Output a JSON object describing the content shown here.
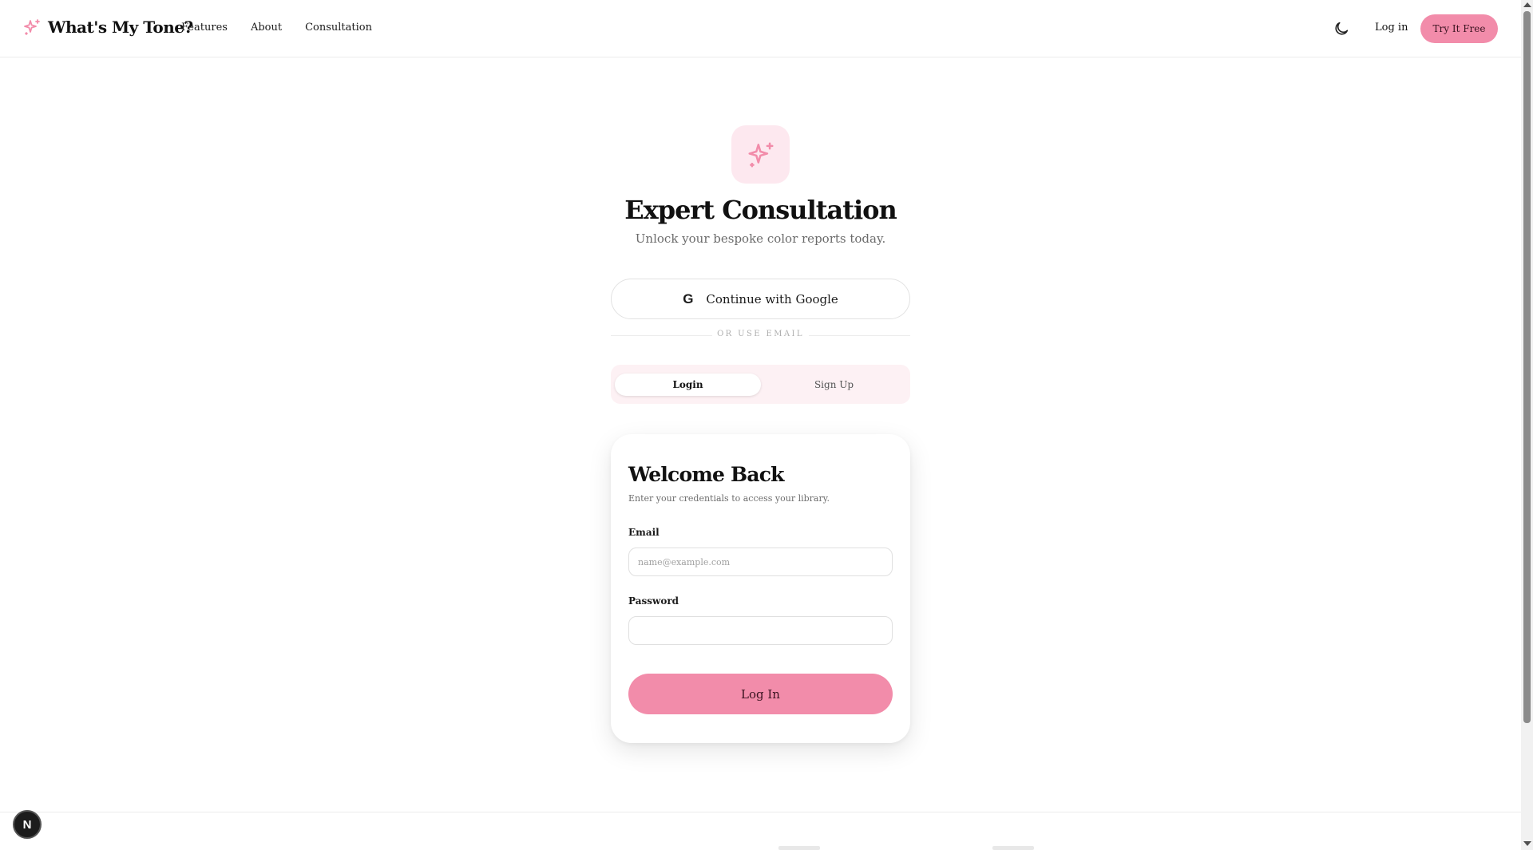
{
  "header": {
    "brand_name": "What's My Tone?",
    "brand_icon": "sparkle-icon",
    "nav": [
      {
        "label": "Features"
      },
      {
        "label": "About"
      },
      {
        "label": "Consultation"
      }
    ],
    "theme_icon": "moon-icon",
    "login_label": "Log in",
    "cta_label": "Try It Free"
  },
  "hero": {
    "icon": "sparkle-icon",
    "title": "Expert Consultation",
    "subtitle": "Unlock your bespoke color reports today."
  },
  "auth": {
    "google_label": "Continue with Google",
    "google_icon": "google-icon",
    "divider_text": "OR USE EMAIL",
    "tabs": [
      {
        "label": "Login",
        "active": true
      },
      {
        "label": "Sign Up",
        "active": false
      }
    ]
  },
  "card": {
    "title": "Welcome Back",
    "subtitle": "Enter your credentials to access your library.",
    "email_label": "Email",
    "email_placeholder": "name@example.com",
    "email_value": "",
    "password_label": "Password",
    "password_value": "",
    "submit_label": "Log In"
  },
  "dev_badge": {
    "label": "N",
    "icon": "nextjs-icon"
  },
  "colors": {
    "accent": "#f28caa",
    "accent_soft": "#fde8ef",
    "tab_bg": "#fdf1f4",
    "text": "#111111",
    "muted": "#6b6b6b"
  }
}
